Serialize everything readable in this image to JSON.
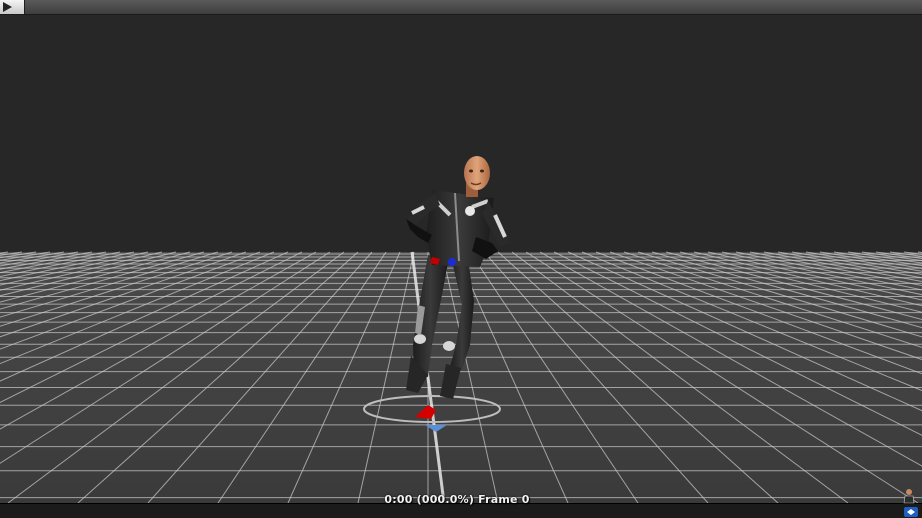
{
  "toolbar": {
    "play_icon": "play-icon"
  },
  "viewport": {
    "background": "#272727",
    "floor_color": "#3b3b3b",
    "grid_color": "#cfcfcf"
  },
  "status": {
    "frame_text": "0:00 (000.0%) Frame 0"
  },
  "icons": {
    "avatar": "avatar-icon",
    "badge": "settings-badge-icon"
  }
}
